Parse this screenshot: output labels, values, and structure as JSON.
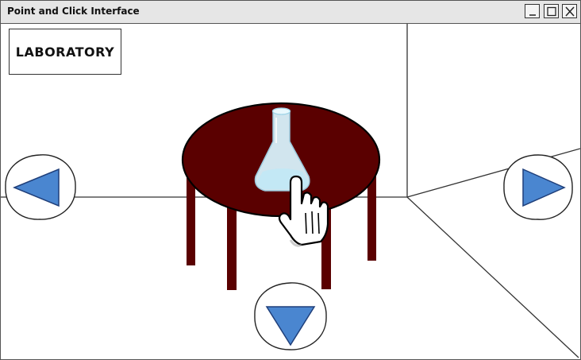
{
  "window": {
    "title": "Point and Click Interface",
    "controls": [
      "minimize",
      "maximize",
      "close"
    ]
  },
  "scene": {
    "location_label": "LABORATORY",
    "objects": [
      {
        "name": "table",
        "color": "#5a0000"
      },
      {
        "name": "flask",
        "color": "#d8f2fb"
      }
    ],
    "cursor": "pointing-hand-icon",
    "navigation": [
      {
        "name": "left",
        "icon": "arrow-left-icon"
      },
      {
        "name": "right",
        "icon": "arrow-right-icon"
      },
      {
        "name": "down",
        "icon": "arrow-down-icon"
      }
    ],
    "colors": {
      "arrow_fill": "#4a86d0",
      "arrow_stroke": "#1f3f7a",
      "table_top": "#5a0000",
      "table_legs": "#5a0000"
    }
  }
}
